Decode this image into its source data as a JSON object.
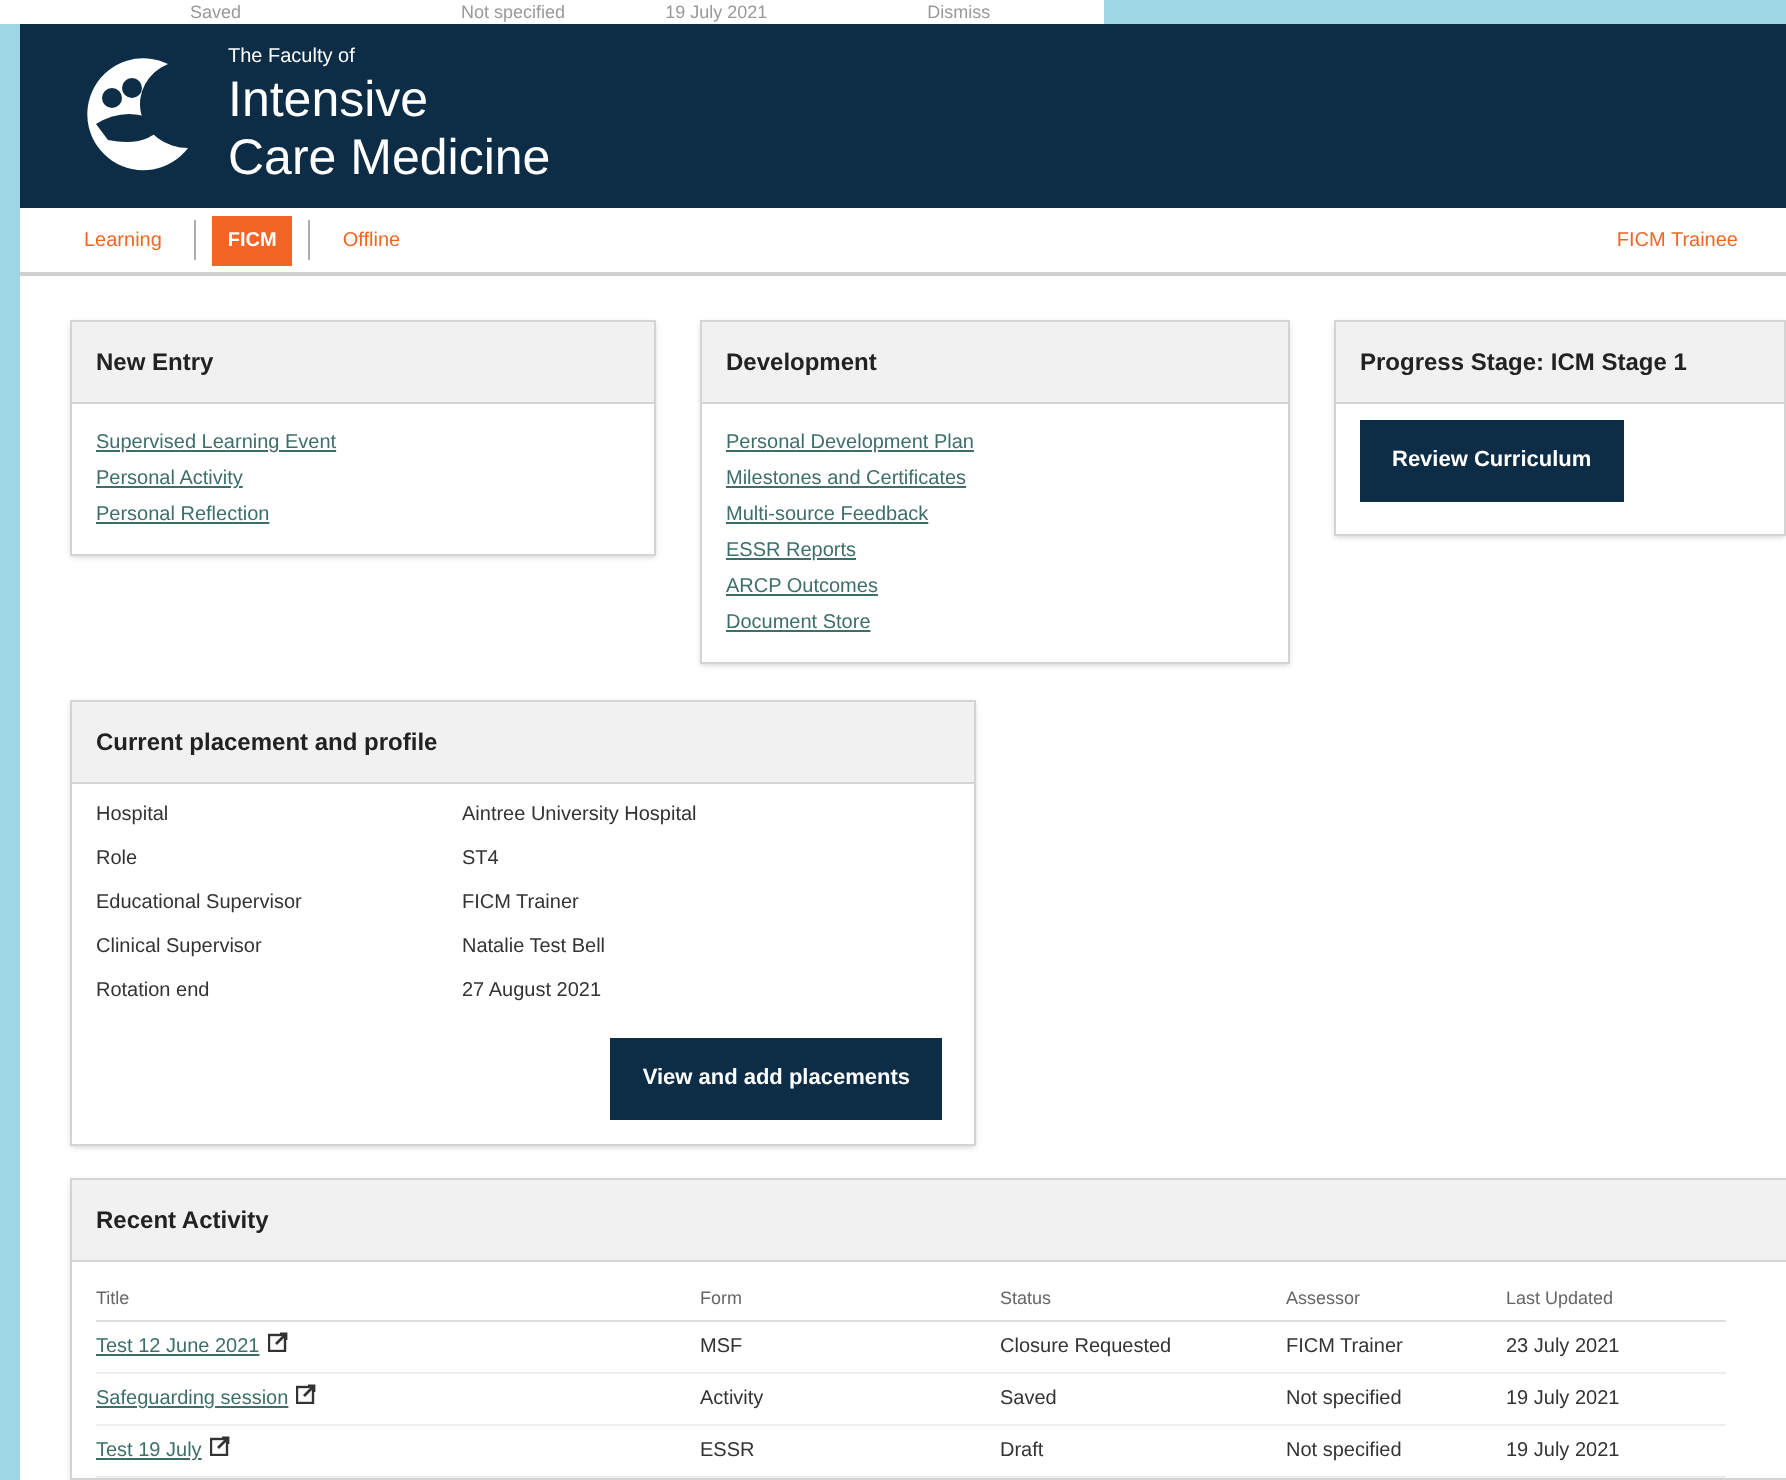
{
  "background_row": {
    "cells": [
      "Saved",
      "Not specified",
      "19 July 2021",
      "Dismiss"
    ]
  },
  "header": {
    "kicker": "The Faculty of",
    "title_line_1": "Intensive",
    "title_line_2": "Care Medicine"
  },
  "nav": {
    "tabs": [
      {
        "label": "Learning",
        "selected": false
      },
      {
        "label": "FICM",
        "selected": true
      },
      {
        "label": "Offline",
        "selected": false
      }
    ],
    "user": "FICM Trainee"
  },
  "new_entry": {
    "title": "New Entry",
    "links": [
      "Supervised Learning Event",
      "Personal Activity",
      "Personal Reflection"
    ]
  },
  "development": {
    "title": "Development",
    "links": [
      "Personal Development Plan",
      "Milestones and Certificates",
      "Multi-source Feedback",
      "ESSR Reports",
      "ARCP Outcomes",
      "Document Store"
    ]
  },
  "progress": {
    "title": "Progress Stage: ICM Stage 1",
    "button": "Review Curriculum"
  },
  "placement": {
    "title": "Current placement and profile",
    "rows": [
      {
        "label": "Hospital",
        "value": "Aintree University Hospital"
      },
      {
        "label": "Role",
        "value": "ST4"
      },
      {
        "label": "Educational Supervisor",
        "value": "FICM Trainer"
      },
      {
        "label": "Clinical Supervisor",
        "value": "Natalie Test Bell"
      },
      {
        "label": "Rotation end",
        "value": "27 August 2021"
      }
    ],
    "button": "View and add placements"
  },
  "recent_activity": {
    "title": "Recent Activity",
    "columns": [
      "Title",
      "Form",
      "Status",
      "Assessor",
      "Last Updated"
    ],
    "rows": [
      {
        "title": "Test 12 June 2021",
        "form": "MSF",
        "status": "Closure Requested",
        "assessor": "FICM Trainer",
        "updated": "23 July 2021"
      },
      {
        "title": "Safeguarding session",
        "form": "Activity",
        "status": "Saved",
        "assessor": "Not specified",
        "updated": "19 July 2021"
      },
      {
        "title": "Test 19 July",
        "form": "ESSR",
        "status": "Draft",
        "assessor": "Not specified",
        "updated": "19 July 2021"
      }
    ]
  }
}
